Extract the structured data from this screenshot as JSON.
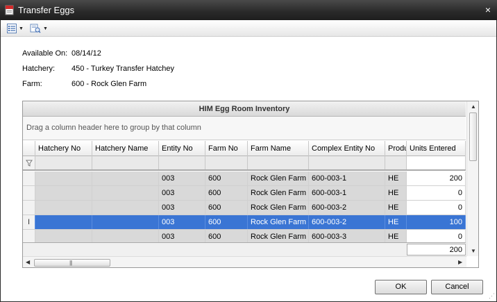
{
  "window": {
    "title": "Transfer Eggs",
    "close_glyph": "×"
  },
  "toolbar": {
    "items": [
      {
        "icon": "list-layout-icon"
      },
      {
        "icon": "print-preview-icon"
      }
    ]
  },
  "info": {
    "available_on": {
      "label": "Available On:",
      "value": "08/14/12"
    },
    "hatchery": {
      "label": "Hatchery:",
      "value": "450 - Turkey Transfer Hatchey"
    },
    "farm": {
      "label": "Farm:",
      "value": "600 - Rock Glen Farm"
    }
  },
  "grid": {
    "caption": "HIM Egg Room Inventory",
    "group_hint": "Drag a column header here to group by that column",
    "columns": [
      "Hatchery No",
      "Hatchery Name",
      "Entity No",
      "Farm No",
      "Farm Name",
      "Complex Entity No",
      "Produ",
      "Units Entered"
    ],
    "rows": [
      {
        "hatchery_no": "",
        "hatchery_name": "",
        "entity_no": "003",
        "farm_no": "600",
        "farm_name": "Rock Glen Farm",
        "complex_entity_no": "600-003-1",
        "product": "HE",
        "units_entered": "200",
        "selected": false
      },
      {
        "hatchery_no": "",
        "hatchery_name": "",
        "entity_no": "003",
        "farm_no": "600",
        "farm_name": "Rock Glen Farm",
        "complex_entity_no": "600-003-1",
        "product": "HE",
        "units_entered": "0",
        "selected": false
      },
      {
        "hatchery_no": "",
        "hatchery_name": "",
        "entity_no": "003",
        "farm_no": "600",
        "farm_name": "Rock Glen Farm",
        "complex_entity_no": "600-003-2",
        "product": "HE",
        "units_entered": "0",
        "selected": false
      },
      {
        "hatchery_no": "",
        "hatchery_name": "",
        "entity_no": "003",
        "farm_no": "600",
        "farm_name": "Rock Glen Farm",
        "complex_entity_no": "600-003-2",
        "product": "HE",
        "units_entered": "100",
        "selected": true
      },
      {
        "hatchery_no": "",
        "hatchery_name": "",
        "entity_no": "003",
        "farm_no": "600",
        "farm_name": "Rock Glen Farm",
        "complex_entity_no": "600-003-3",
        "product": "HE",
        "units_entered": "0",
        "selected": false
      }
    ],
    "total_units": "200",
    "selected_row_indicator": "I"
  },
  "buttons": {
    "ok": "OK",
    "cancel": "Cancel"
  },
  "colors": {
    "selection": "#3a75d4",
    "titlebar": "#2b2b2b",
    "grey_cell": "#d9d9d9"
  }
}
